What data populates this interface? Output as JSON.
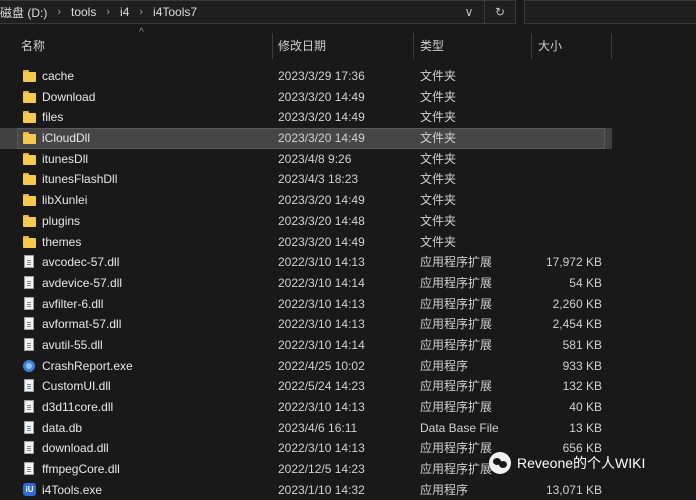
{
  "address_bar": {
    "breadcrumbs": [
      "磁盘 (D:)",
      "tools",
      "i4",
      "i4Tools7"
    ],
    "dropdown_icon": "chevron-down-icon",
    "refresh_icon": "refresh-icon"
  },
  "columns": {
    "name": "名称",
    "modified": "修改日期",
    "type": "类型",
    "size": "大小"
  },
  "files": [
    {
      "name": "cache",
      "date": "2023/3/29 17:36",
      "type": "文件夹",
      "size": "",
      "icon": "folder-icon"
    },
    {
      "name": "Download",
      "date": "2023/3/20 14:49",
      "type": "文件夹",
      "size": "",
      "icon": "folder-icon"
    },
    {
      "name": "files",
      "date": "2023/3/20 14:49",
      "type": "文件夹",
      "size": "",
      "icon": "folder-icon"
    },
    {
      "name": "iCloudDll",
      "date": "2023/3/20 14:49",
      "type": "文件夹",
      "size": "",
      "icon": "folder-icon",
      "selected": true
    },
    {
      "name": "itunesDll",
      "date": "2023/4/8 9:26",
      "type": "文件夹",
      "size": "",
      "icon": "folder-icon"
    },
    {
      "name": "itunesFlashDll",
      "date": "2023/4/3 18:23",
      "type": "文件夹",
      "size": "",
      "icon": "folder-icon"
    },
    {
      "name": "libXunlei",
      "date": "2023/3/20 14:49",
      "type": "文件夹",
      "size": "",
      "icon": "folder-icon"
    },
    {
      "name": "plugins",
      "date": "2023/3/20 14:48",
      "type": "文件夹",
      "size": "",
      "icon": "folder-icon"
    },
    {
      "name": "themes",
      "date": "2023/3/20 14:49",
      "type": "文件夹",
      "size": "",
      "icon": "folder-icon"
    },
    {
      "name": "avcodec-57.dll",
      "date": "2022/3/10 14:13",
      "type": "应用程序扩展",
      "size": "17,972 KB",
      "icon": "file-icon"
    },
    {
      "name": "avdevice-57.dll",
      "date": "2022/3/10 14:14",
      "type": "应用程序扩展",
      "size": "54 KB",
      "icon": "file-icon"
    },
    {
      "name": "avfilter-6.dll",
      "date": "2022/3/10 14:13",
      "type": "应用程序扩展",
      "size": "2,260 KB",
      "icon": "file-icon"
    },
    {
      "name": "avformat-57.dll",
      "date": "2022/3/10 14:13",
      "type": "应用程序扩展",
      "size": "2,454 KB",
      "icon": "file-icon"
    },
    {
      "name": "avutil-55.dll",
      "date": "2022/3/10 14:14",
      "type": "应用程序扩展",
      "size": "581 KB",
      "icon": "file-icon"
    },
    {
      "name": "CrashReport.exe",
      "date": "2022/4/25 10:02",
      "type": "应用程序",
      "size": "933 KB",
      "icon": "crash-report-icon"
    },
    {
      "name": "CustomUI.dll",
      "date": "2022/5/24 14:23",
      "type": "应用程序扩展",
      "size": "132 KB",
      "icon": "file-icon"
    },
    {
      "name": "d3d11core.dll",
      "date": "2022/3/10 14:13",
      "type": "应用程序扩展",
      "size": "40 KB",
      "icon": "file-icon"
    },
    {
      "name": "data.db",
      "date": "2023/4/6 16:11",
      "type": "Data Base File",
      "size": "13 KB",
      "icon": "file-icon"
    },
    {
      "name": "download.dll",
      "date": "2022/3/10 14:13",
      "type": "应用程序扩展",
      "size": "656 KB",
      "icon": "file-icon"
    },
    {
      "name": "ffmpegCore.dll",
      "date": "2022/12/5 14:23",
      "type": "应用程序扩展",
      "size": "",
      "icon": "file-icon"
    },
    {
      "name": "i4Tools.exe",
      "date": "2023/1/10 14:32",
      "type": "应用程序",
      "size": "13,071 KB",
      "icon": "i4-app-icon"
    }
  ],
  "watermark": "Reveone的个人WIKI"
}
